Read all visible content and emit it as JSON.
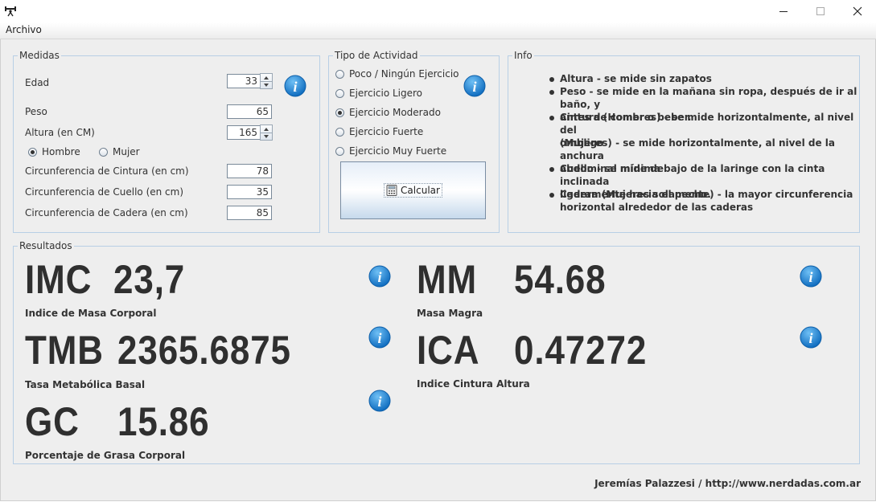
{
  "menu": {
    "file": "Archivo"
  },
  "medidas": {
    "title": "Medidas",
    "edad": {
      "label": "Edad",
      "value": "33"
    },
    "peso": {
      "label": "Peso",
      "value": "65"
    },
    "altura": {
      "label": "Altura (en CM)",
      "value": "165"
    },
    "sexo": {
      "hombre": "Hombre",
      "mujer": "Mujer",
      "selected": "Hombre"
    },
    "cintura": {
      "label": "Circunferencia de Cintura (en cm)",
      "value": "78"
    },
    "cuello": {
      "label": "Circunferencia de Cuello (en cm)",
      "value": "35"
    },
    "cadera": {
      "label": "Circunferencia de Cadera (en cm)",
      "value": "85"
    }
  },
  "actividad": {
    "title": "Tipo de Actividad",
    "options": [
      "Poco / Ningún Ejercicio",
      "Ejercicio Ligero",
      "Ejercicio Moderado",
      "Ejercicio Fuerte",
      "Ejercicio Muy Fuerte"
    ],
    "selected": "Ejercicio Moderado",
    "button": "Calcular"
  },
  "info": {
    "title": "Info",
    "items": [
      {
        "bold": "Altura",
        "text": " - se mide sin zapatos",
        "line2": ""
      },
      {
        "bold": "Peso",
        "text": " - se mide en la mañana sin ropa, después de ir al baño, y",
        "line2": "antes de comer o beber."
      },
      {
        "bold": "Cintura (Hombres)",
        "text": " - se mide horizontalmente, al nivel del",
        "line2": "ombligo"
      },
      {
        "bold": "",
        "text": "(Mujeres) - se mide horizontalmente, al nivel de la anchura",
        "line2": "abdominal mínima"
      },
      {
        "bold": "Cuello",
        "text": " - se mide debajo de la laringe con la cinta inclinada",
        "line2": "ligeramente hacia el pecho."
      },
      {
        "bold": "Cadera (Mujeres solamente)",
        "text": " - la mayor circunferencia",
        "line2": "horizontal alrededor de las caderas"
      }
    ]
  },
  "resultados": {
    "title": "Resultados",
    "imc": {
      "abbr": "IMC",
      "value": "23,7",
      "desc": "Indice de Masa Corporal"
    },
    "tmb": {
      "abbr": "TMB",
      "value": "2365.6875",
      "desc": "Tasa Metabólica Basal"
    },
    "gc": {
      "abbr": "GC",
      "value": "15.86",
      "desc": "Porcentaje de Grasa Corporal"
    },
    "mm": {
      "abbr": "MM",
      "value": "54.68",
      "desc": "Masa Magra"
    },
    "ica": {
      "abbr": "ICA",
      "value": "0.47272",
      "desc": "Indice Cintura Altura"
    }
  },
  "footer": "Jeremías Palazzesi / http://www.nerdadas.com.ar",
  "colors": {
    "info_icon": "#1e82d2",
    "panel_border": "#b8cfe5",
    "background": "#eeeeee"
  }
}
